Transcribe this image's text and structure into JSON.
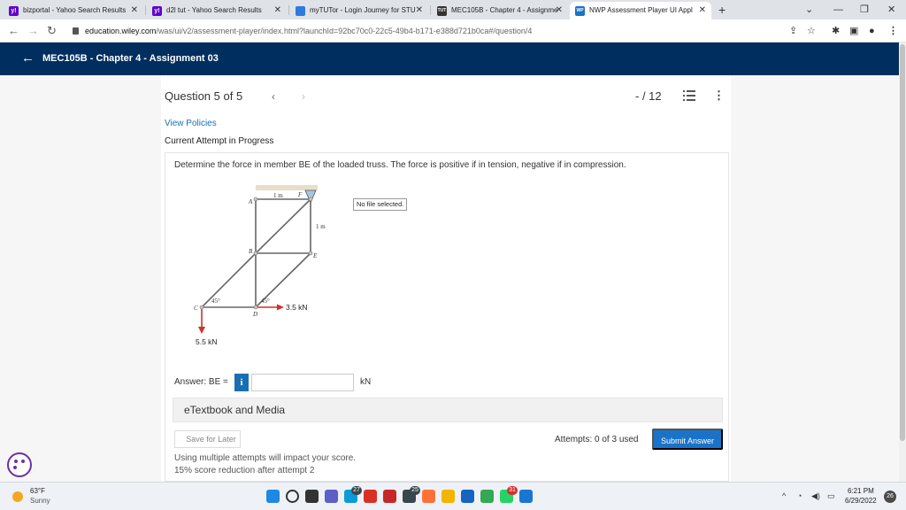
{
  "browser": {
    "tabs": [
      {
        "label": "bizportal - Yahoo Search Results",
        "favicon_color": "#5f01d1",
        "favicon_text": "y!"
      },
      {
        "label": "d2l tut - Yahoo Search Results",
        "favicon_color": "#5f01d1",
        "favicon_text": "y!"
      },
      {
        "label": "myTUTor - Login Journey for STU",
        "favicon_color": "#2d7be0",
        "favicon_text": ""
      },
      {
        "label": "MEC105B - Chapter 4 - Assignme",
        "favicon_color": "#333333",
        "favicon_text": "TUT"
      },
      {
        "label": "NWP Assessment Player UI Appl",
        "favicon_color": "#1a73c8",
        "favicon_text": "WP"
      }
    ],
    "active_tab": 4,
    "new_tab_symbol": "+",
    "url_host": "education.wiley.com",
    "url_path": "/was/ui/v2/assessment-player/index.html?launchId=92bc70c0-22c5-49b4-b171-e388d721b0ca#/question/4"
  },
  "header": {
    "back_symbol": "←",
    "title": "MEC105B - Chapter 4 - Assignment 03"
  },
  "question_nav": {
    "label": "Question 5 of 5",
    "prev_symbol": "‹",
    "next_symbol": "›",
    "score": "- / 12",
    "more_symbol": "⋮"
  },
  "links": {
    "view_policies": "View Policies",
    "attempt_status": "Current Attempt in Progress"
  },
  "question": {
    "text": "Determine the force in member BE of the loaded truss. The force is positive if in tension, negative if in compression.",
    "figure": {
      "labels": {
        "A": "A",
        "B": "B",
        "C": "C",
        "D": "D",
        "E": "E",
        "F": "F"
      },
      "dim_top": "1 m",
      "dim_right": "1 m",
      "angle_left": "45°",
      "angle_right": "45°",
      "load_horizontal": "3.5 kN",
      "load_vertical": "5.5 kN"
    },
    "file_status": "No file selected."
  },
  "answer": {
    "label": "Answer: BE =",
    "info_symbol": "i",
    "value": "",
    "unit": "kN"
  },
  "etextbook": "eTextbook and Media",
  "actions": {
    "save_later": "Save for Later",
    "attempts": "Attempts: 0 of 3 used",
    "submit": "Submit Answer"
  },
  "warnings": {
    "line1": "Using multiple attempts will impact your score.",
    "line2": "15% score reduction after attempt 2"
  },
  "taskbar": {
    "temperature": "63°F",
    "condition": "Sunny",
    "apps": [
      {
        "name": "windows-start",
        "color": "#1e88e5",
        "badge": ""
      },
      {
        "name": "search",
        "color": "#333333",
        "badge": ""
      },
      {
        "name": "task-view",
        "color": "#333333",
        "badge": ""
      },
      {
        "name": "chat",
        "color": "#5b5fc7",
        "badge": ""
      },
      {
        "name": "edge",
        "color": "#0c9bd8",
        "badge": "27"
      },
      {
        "name": "app-red",
        "color": "#d93025",
        "badge": ""
      },
      {
        "name": "app-red-2",
        "color": "#c62828",
        "badge": ""
      },
      {
        "name": "app-dark",
        "color": "#37474f",
        "badge": "25"
      },
      {
        "name": "firefox",
        "color": "#ff7139",
        "badge": ""
      },
      {
        "name": "files",
        "color": "#f4b400",
        "badge": ""
      },
      {
        "name": "app-u",
        "color": "#1565c0",
        "badge": ""
      },
      {
        "name": "chrome",
        "color": "#34a853",
        "badge": ""
      },
      {
        "name": "whatsapp",
        "color": "#25d366",
        "badge": "31"
      },
      {
        "name": "app-blue",
        "color": "#1976d2",
        "badge": ""
      }
    ],
    "time": "6:21 PM",
    "date": "6/29/2022",
    "notification_count": "26"
  },
  "colors": {
    "header_bg": "#002f5f",
    "link": "#1a6fb3",
    "submit_bg": "#1a73c8",
    "load_arrow": "#d32f2f"
  }
}
